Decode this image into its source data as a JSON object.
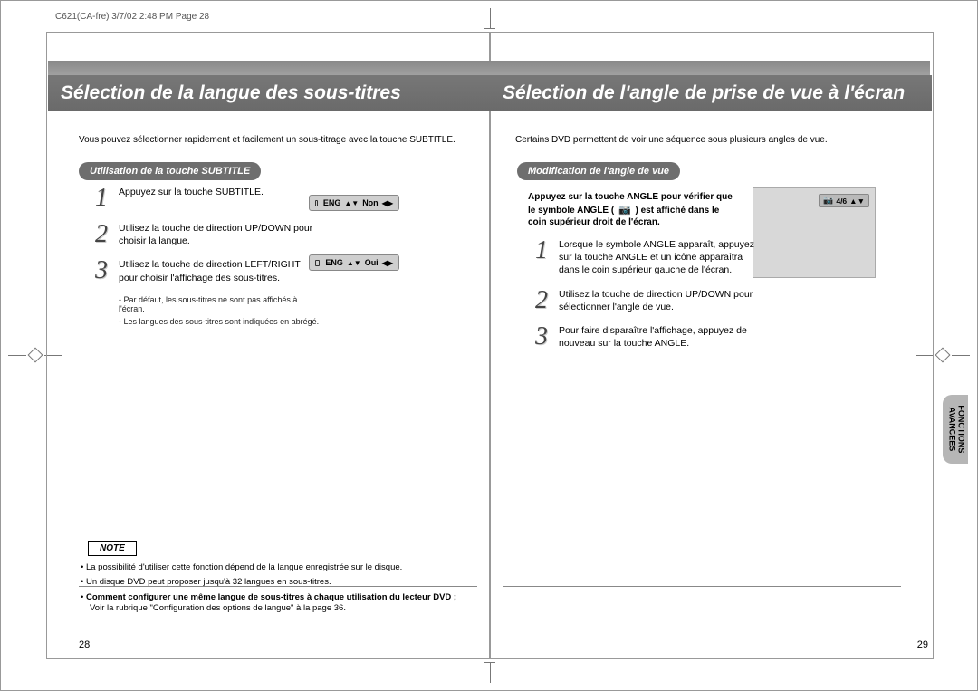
{
  "meta": {
    "header": "C621(CA-fre) 3/7/02 2:48 PM Page 28"
  },
  "left": {
    "title": "Sélection de la langue des sous-titres",
    "intro": "Vous pouvez sélectionner rapidement et facilement un sous-titrage avec la touche SUBTITLE.",
    "pill": "Utilisation de la touche SUBTITLE",
    "steps": {
      "s1": "Appuyez sur la touche SUBTITLE.",
      "s2": "Utilisez la touche de direction UP/DOWN pour choisir la langue.",
      "s3": "Utilisez la touche de direction LEFT/RIGHT pour choisir l'affichage des sous-titres."
    },
    "subnote1": "- Par défaut, les sous-titres ne sont pas affichés à l'écran.",
    "subnote2": "- Les langues des sous-titres sont indiquées en abrégé.",
    "osd1": {
      "a": "ENG",
      "b": "Non"
    },
    "osd2": {
      "a": "ENG",
      "b": "Oui"
    },
    "noteLabel": "NOTE",
    "notes": {
      "n1": "La possibilité d'utiliser cette fonction dépend de la langue enregistrée sur le disque.",
      "n2": "Un disque DVD peut proposer jusqu'à 32 langues en sous-titres.",
      "n3": "Comment configurer une même langue de sous-titres à chaque utilisation du lecteur DVD ;",
      "n4": "Voir la rubrique \"Configuration des options de langue\" à la page 36."
    },
    "pagenum": "28"
  },
  "right": {
    "title": "Sélection de l'angle de prise de vue à l'écran",
    "intro": "Certains DVD permettent de voir une séquence sous plusieurs angles de vue.",
    "pill": "Modification de l'angle de vue",
    "note": {
      "a": "Appuyez sur la touche ANGLE pour vérifier que le symbole ANGLE (",
      "b": ") est affiché dans le coin supérieur droit de l'écran."
    },
    "steps": {
      "s1": "Lorsque le symbole ANGLE apparaît, appuyez sur la touche ANGLE et un icône apparaîtra dans le coin supérieur gauche de l'écran.",
      "s2": "Utilisez la touche de direction UP/DOWN pour sélectionner l'angle de vue.",
      "s3": "Pour faire disparaître l'affichage, appuyez de nouveau sur la touche ANGLE."
    },
    "tvchip": "4/6",
    "pagenum": "29"
  },
  "sidetab": {
    "l1": "FONCTIONS",
    "l2": "AVANCEES"
  }
}
